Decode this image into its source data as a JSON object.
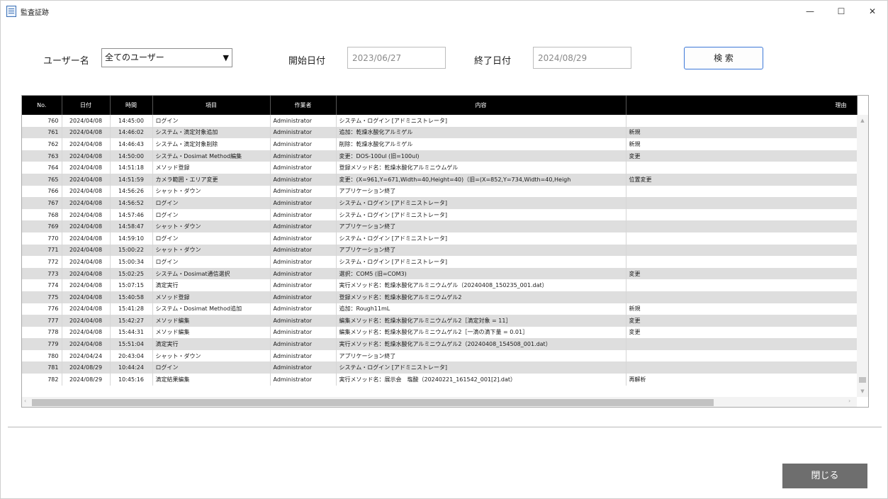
{
  "window": {
    "title": "監査証跡"
  },
  "window_controls": {
    "minimize": "—",
    "maximize": "☐",
    "close": "✕"
  },
  "filters": {
    "user_label": "ユーザー名",
    "user_value": "全てのユーザー",
    "start_label": "開始日付",
    "start_value": "2023/06/27",
    "end_label": "終了日付",
    "end_value": "2024/08/29",
    "search_label": "検 索"
  },
  "table": {
    "headers": [
      "No.",
      "日付",
      "時間",
      "項目",
      "作業者",
      "内容",
      "理由"
    ],
    "rows": [
      [
        "760",
        "2024/04/08",
        "14:45:00",
        "ログイン",
        "Administrator",
        "システム・ログイン [アドミニストレータ]",
        ""
      ],
      [
        "761",
        "2024/04/08",
        "14:46:02",
        "システム・滴定対象追加",
        "Administrator",
        "追加：乾燥水酸化アルミゲル",
        "新規"
      ],
      [
        "762",
        "2024/04/08",
        "14:46:43",
        "システム・滴定対象削除",
        "Administrator",
        "削除：乾燥水酸化アルミゲル",
        "新規"
      ],
      [
        "763",
        "2024/04/08",
        "14:50:00",
        "システム・Dosimat Method編集",
        "Administrator",
        "変更：DOS-100ul (旧=100ul)",
        "変更"
      ],
      [
        "764",
        "2024/04/08",
        "14:51:18",
        "メソッド登録",
        "Administrator",
        "登録メソッド名：乾燥水酸化アルミニウムゲル",
        ""
      ],
      [
        "765",
        "2024/04/08",
        "14:51:59",
        "カメラ範囲・エリア変更",
        "Administrator",
        "変更：(X=961,Y=671,Width=40,Height=40)（旧=(X=852,Y=734,Width=40,Heigh",
        "位置変更"
      ],
      [
        "766",
        "2024/04/08",
        "14:56:26",
        "シャット・ダウン",
        "Administrator",
        "アプリケーション終了",
        ""
      ],
      [
        "767",
        "2024/04/08",
        "14:56:52",
        "ログイン",
        "Administrator",
        "システム・ログイン [アドミニストレータ]",
        ""
      ],
      [
        "768",
        "2024/04/08",
        "14:57:46",
        "ログイン",
        "Administrator",
        "システム・ログイン [アドミニストレータ]",
        ""
      ],
      [
        "769",
        "2024/04/08",
        "14:58:47",
        "シャット・ダウン",
        "Administrator",
        "アプリケーション終了",
        ""
      ],
      [
        "770",
        "2024/04/08",
        "14:59:10",
        "ログイン",
        "Administrator",
        "システム・ログイン [アドミニストレータ]",
        ""
      ],
      [
        "771",
        "2024/04/08",
        "15:00:22",
        "シャット・ダウン",
        "Administrator",
        "アプリケーション終了",
        ""
      ],
      [
        "772",
        "2024/04/08",
        "15:00:34",
        "ログイン",
        "Administrator",
        "システム・ログイン [アドミニストレータ]",
        ""
      ],
      [
        "773",
        "2024/04/08",
        "15:02:25",
        "システム・Dosimat通信選択",
        "Administrator",
        "選択：COM5 (旧=COM3)",
        "変更"
      ],
      [
        "774",
        "2024/04/08",
        "15:07:15",
        "滴定実行",
        "Administrator",
        "実行メソッド名：乾燥水酸化アルミニウムゲル（20240408_150235_001.dat）",
        ""
      ],
      [
        "775",
        "2024/04/08",
        "15:40:58",
        "メソッド登録",
        "Administrator",
        "登録メソッド名：乾燥水酸化アルミニウムゲル2",
        ""
      ],
      [
        "776",
        "2024/04/08",
        "15:41:28",
        "システム・Dosimat Method追加",
        "Administrator",
        "追加：Rough11mL",
        "新規"
      ],
      [
        "777",
        "2024/04/08",
        "15:42:27",
        "メソッド編集",
        "Administrator",
        "編集メソッド名：乾燥水酸化アルミニウムゲル2［滴定対象 = 11］",
        "変更"
      ],
      [
        "778",
        "2024/04/08",
        "15:44:31",
        "メソッド編集",
        "Administrator",
        "編集メソッド名：乾燥水酸化アルミニウムゲル2［一滴の滴下量 = 0.01］",
        "変更"
      ],
      [
        "779",
        "2024/04/08",
        "15:51:04",
        "滴定実行",
        "Administrator",
        "実行メソッド名：乾燥水酸化アルミニウムゲル2（20240408_154508_001.dat）",
        ""
      ],
      [
        "780",
        "2024/04/24",
        "20:43:04",
        "シャット・ダウン",
        "Administrator",
        "アプリケーション終了",
        ""
      ],
      [
        "781",
        "2024/08/29",
        "10:44:24",
        "ログイン",
        "Administrator",
        "システム・ログイン [アドミニストレータ]",
        ""
      ],
      [
        "782",
        "2024/08/29",
        "10:45:16",
        "滴定結果編集",
        "Administrator",
        "実行メソッド名：展示会　塩酸（20240221_161542_001[2].dat）",
        "再解析"
      ]
    ]
  },
  "footer": {
    "close_label": "閉じる"
  }
}
